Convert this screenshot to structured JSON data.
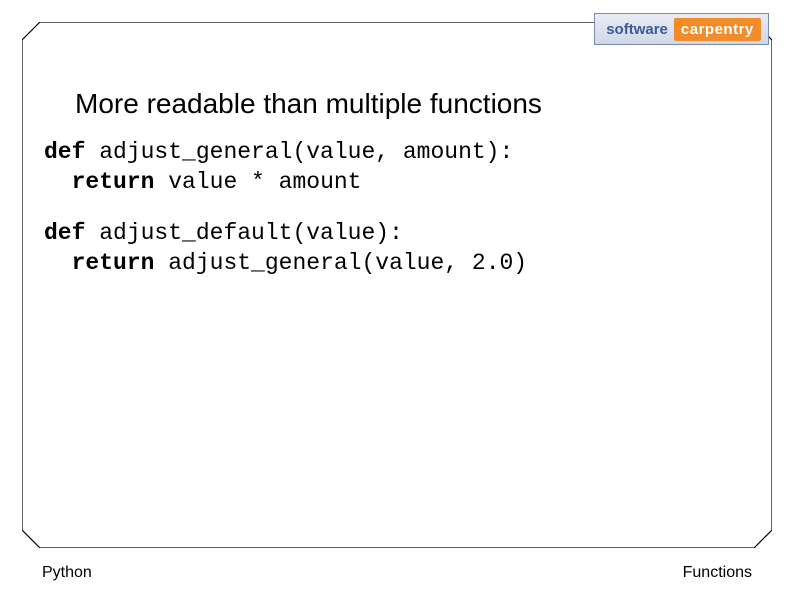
{
  "logo": {
    "left": "software",
    "right": "carpentry"
  },
  "title": "More readable than multiple functions",
  "code": {
    "block1": {
      "line1_kw": "def",
      "line1_rest": " adjust_general(value, amount):",
      "line2_indent": "  ",
      "line2_kw": "return",
      "line2_rest": " value * amount"
    },
    "block2": {
      "line1_kw": "def",
      "line1_rest": " adjust_default(value):",
      "line2_indent": "  ",
      "line2_kw": "return",
      "line2_rest": " adjust_general(value, 2.0)"
    }
  },
  "footer": {
    "left": "Python",
    "right": "Functions"
  }
}
